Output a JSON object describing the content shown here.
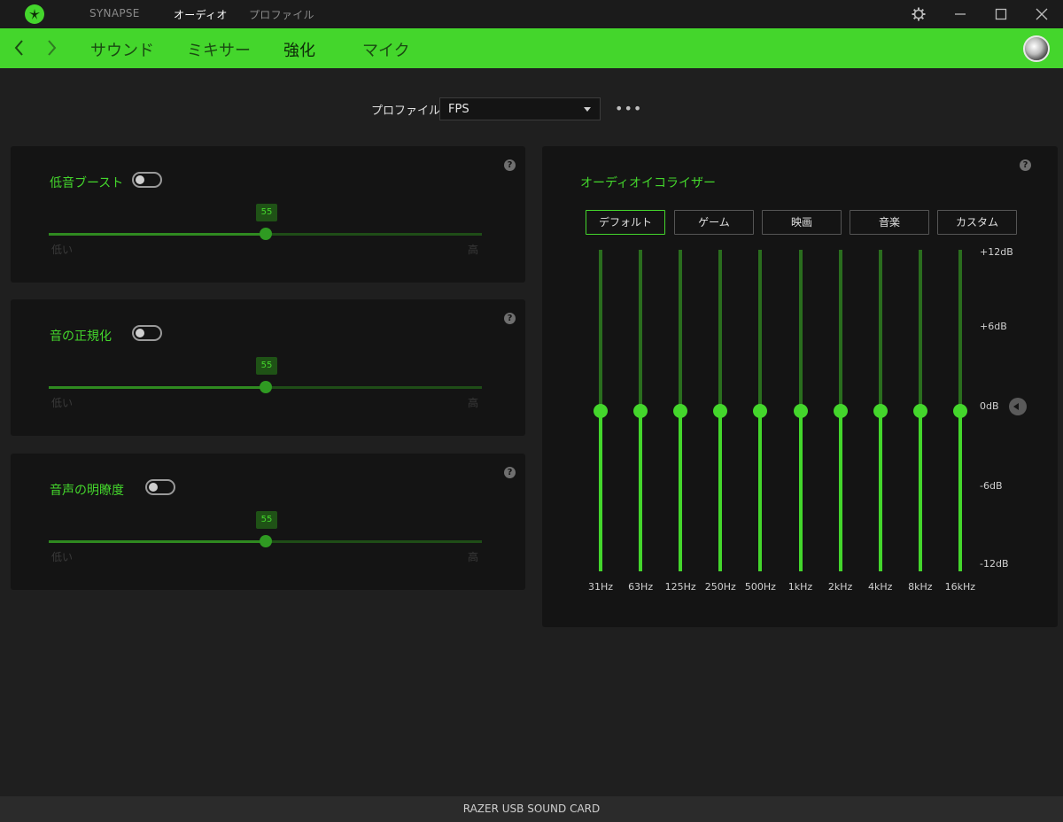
{
  "titlebar": {
    "tabs": [
      {
        "label": "SYNAPSE",
        "active": false
      },
      {
        "label": "オーディオ",
        "active": true
      },
      {
        "label": "プロファイル",
        "active": false
      }
    ],
    "icons": [
      "gear-icon",
      "minimize-icon",
      "maximize-icon",
      "close-icon"
    ]
  },
  "nav": {
    "items": [
      {
        "label": "サウンド"
      },
      {
        "label": "ミキサー"
      },
      {
        "label": "強化",
        "active": true
      },
      {
        "label": "マイク"
      }
    ],
    "accent_color": "#44d62c"
  },
  "profile": {
    "label": "プロファイル",
    "selected": "FPS",
    "more": "•••"
  },
  "panels": [
    {
      "title": "低音ブースト",
      "value": "55",
      "low": "低い",
      "high": "高",
      "enabled": false,
      "fraction": 0.5
    },
    {
      "title": "音の正規化",
      "value": "55",
      "low": "低い",
      "high": "高",
      "enabled": false,
      "fraction": 0.5
    },
    {
      "title": "音声の明瞭度",
      "value": "55",
      "low": "低い",
      "high": "高",
      "enabled": false,
      "fraction": 0.5
    }
  ],
  "equalizer": {
    "title": "オーディオイコライザー",
    "presets": [
      {
        "label": "デフォルト",
        "active": true
      },
      {
        "label": "ゲーム"
      },
      {
        "label": "映画"
      },
      {
        "label": "音楽"
      },
      {
        "label": "カスタム"
      }
    ],
    "db_labels": [
      "+12dB",
      "+6dB",
      "0dB",
      "-6dB",
      "-12dB"
    ],
    "bands": [
      {
        "freq": "31Hz",
        "gain_db": 0
      },
      {
        "freq": "63Hz",
        "gain_db": 0
      },
      {
        "freq": "125Hz",
        "gain_db": 0
      },
      {
        "freq": "250Hz",
        "gain_db": 0
      },
      {
        "freq": "500Hz",
        "gain_db": 0
      },
      {
        "freq": "1kHz",
        "gain_db": 0
      },
      {
        "freq": "2kHz",
        "gain_db": 0
      },
      {
        "freq": "4kHz",
        "gain_db": 0
      },
      {
        "freq": "8kHz",
        "gain_db": 0
      },
      {
        "freq": "16kHz",
        "gain_db": 0
      }
    ]
  },
  "footer": {
    "device": "RAZER USB SOUND CARD"
  },
  "help_glyph": "?"
}
